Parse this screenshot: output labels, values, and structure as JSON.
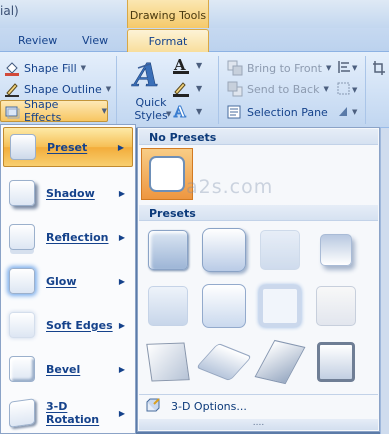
{
  "app": {
    "title_fragment": "ial)"
  },
  "context_tab": {
    "label": "Drawing Tools"
  },
  "tabs": [
    {
      "label": "Review"
    },
    {
      "label": "View"
    },
    {
      "label": "Format"
    }
  ],
  "ribbon": {
    "shape_fill": "Shape Fill",
    "shape_outline": "Shape Outline",
    "shape_effects": "Shape Effects",
    "quick_styles": "Quick Styles",
    "bring_to_front": "Bring to Front",
    "send_to_back": "Send to Back",
    "selection_pane": "Selection Pane"
  },
  "effects_menu": {
    "items": [
      {
        "label": "Preset",
        "active": true
      },
      {
        "label": "Shadow"
      },
      {
        "label": "Reflection"
      },
      {
        "label": "Glow"
      },
      {
        "label": "Soft Edges"
      },
      {
        "label": "Bevel"
      },
      {
        "label": "3-D Rotation"
      }
    ]
  },
  "preset_submenu": {
    "no_presets_header": "No Presets",
    "presets_header": "Presets",
    "options_label": "3-D Options...",
    "grip": "....",
    "watermark": "a2s.com"
  }
}
